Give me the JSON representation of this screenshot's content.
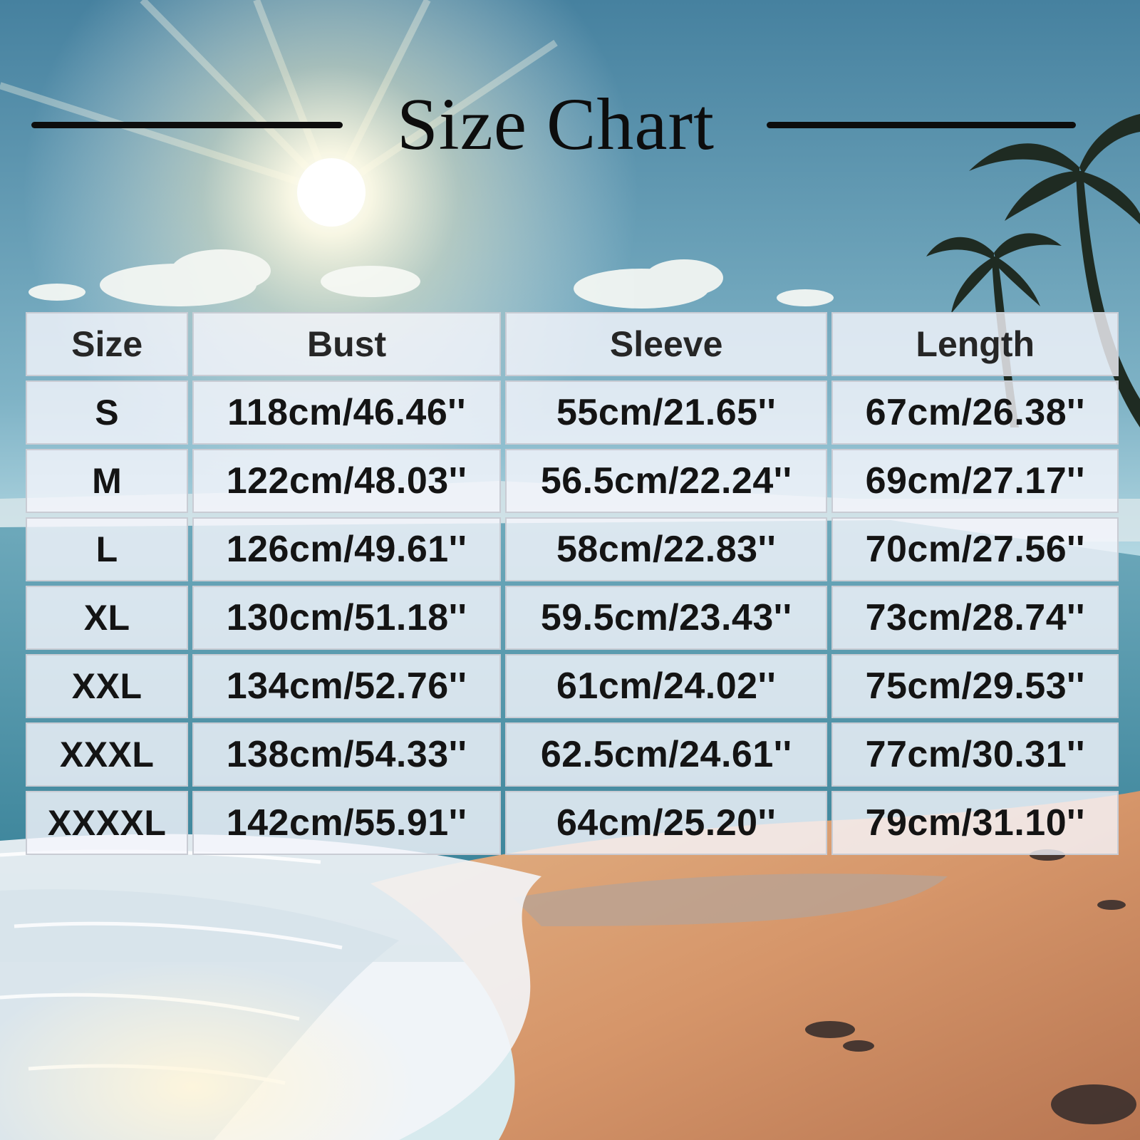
{
  "title": "Size Chart",
  "columns": [
    "Size",
    "Bust",
    "Sleeve",
    "Length"
  ],
  "rows": [
    [
      "S",
      "118cm/46.46''",
      "55cm/21.65''",
      "67cm/26.38''"
    ],
    [
      "M",
      "122cm/48.03''",
      "56.5cm/22.24''",
      "69cm/27.17''"
    ],
    [
      "L",
      "126cm/49.61''",
      "58cm/22.83''",
      "70cm/27.56''"
    ],
    [
      "XL",
      "130cm/51.18''",
      "59.5cm/23.43''",
      "73cm/28.74''"
    ],
    [
      "XXL",
      "134cm/52.76''",
      "61cm/24.02''",
      "75cm/29.53''"
    ],
    [
      "XXXL",
      "138cm/54.33''",
      "62.5cm/24.61''",
      "77cm/30.31''"
    ],
    [
      "XXXXL",
      "142cm/55.91''",
      "64cm/25.20''",
      "79cm/31.10''"
    ]
  ],
  "background": {
    "scene": "beach-sunset",
    "sky_top": "#4f86a3",
    "sky_horizon": "#b9dbe6",
    "sea": "#3f8fa6",
    "sand": "#d89b6e",
    "foam": "#f4f7fb"
  }
}
